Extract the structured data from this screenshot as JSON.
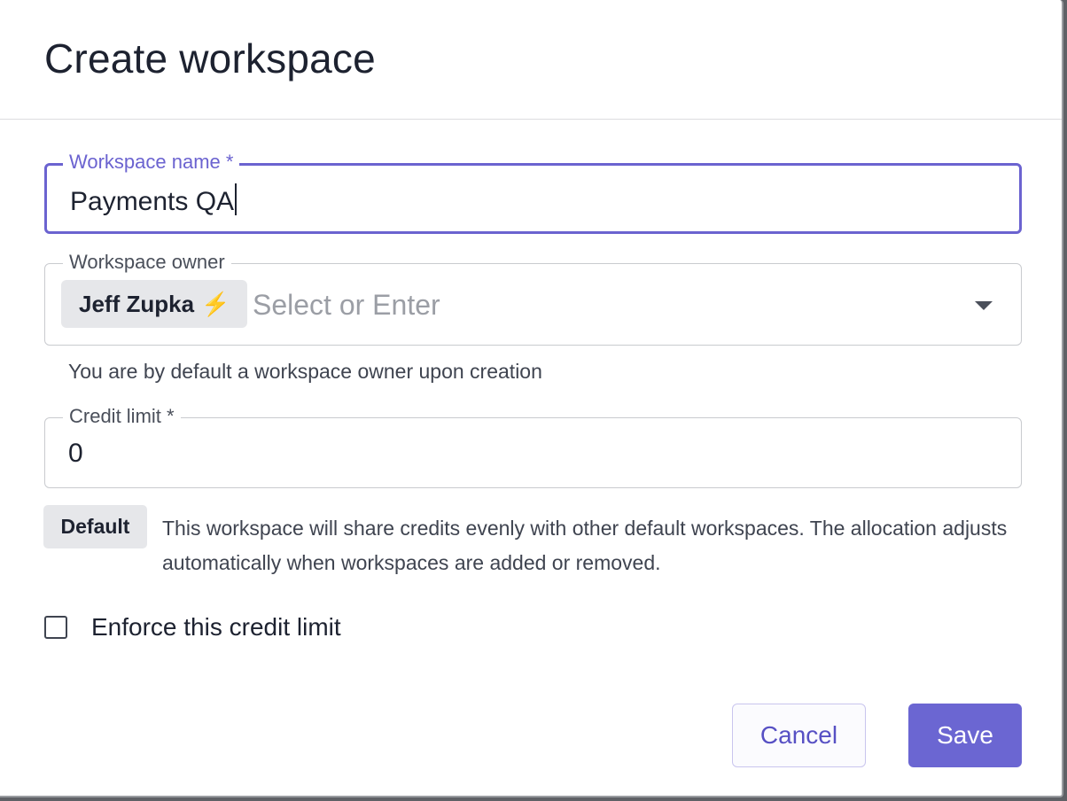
{
  "dialog": {
    "title": "Create workspace"
  },
  "workspace_name": {
    "label": "Workspace name *",
    "value": "Payments QA"
  },
  "workspace_owner": {
    "label": "Workspace owner",
    "selected_chip": "Jeff Zupka",
    "chip_icon": "bolt-icon",
    "placeholder": "Select or Enter",
    "helper": "You are by default a workspace owner upon creation"
  },
  "credit_limit": {
    "label": "Credit limit *",
    "value": "0",
    "badge": "Default",
    "description": "This workspace will share credits evenly with other default workspaces. The allocation adjusts automatically when workspaces are added or removed."
  },
  "enforce": {
    "label": "Enforce this credit limit",
    "checked": false
  },
  "actions": {
    "cancel_label": "Cancel",
    "save_label": "Save"
  },
  "colors": {
    "accent": "#6b66d2",
    "focus_border": "#6b63d0",
    "chip_bg": "#e6e7ea",
    "bolt": "#f2b52a"
  }
}
